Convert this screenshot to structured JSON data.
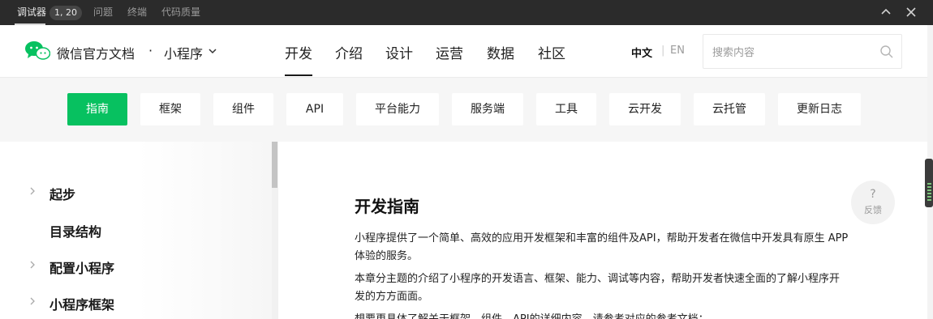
{
  "devtools": {
    "tabs": [
      {
        "label": "调试器",
        "active": true
      },
      {
        "label": "问题"
      },
      {
        "label": "终端"
      },
      {
        "label": "代码质量"
      }
    ],
    "badge": "1, 20",
    "collapse_icon": "chevron-up-icon",
    "close_icon": "close-icon"
  },
  "header": {
    "site_title": "微信官方文档",
    "separator": "·",
    "product": "小程序",
    "nav": [
      {
        "label": "开发",
        "active": true
      },
      {
        "label": "介绍"
      },
      {
        "label": "设计"
      },
      {
        "label": "运营"
      },
      {
        "label": "数据"
      },
      {
        "label": "社区"
      }
    ],
    "lang": {
      "zh": "中文",
      "sep": "|",
      "en": "EN"
    },
    "search": {
      "placeholder": "搜索内容",
      "value": ""
    }
  },
  "categories": [
    {
      "label": "指南",
      "active": true
    },
    {
      "label": "框架"
    },
    {
      "label": "组件"
    },
    {
      "label": "API"
    },
    {
      "label": "平台能力"
    },
    {
      "label": "服务端"
    },
    {
      "label": "工具"
    },
    {
      "label": "云开发"
    },
    {
      "label": "云托管"
    },
    {
      "label": "更新日志"
    }
  ],
  "sidebar": {
    "items": [
      {
        "label": "起步",
        "expandable": true
      },
      {
        "label": "目录结构",
        "expandable": false
      },
      {
        "label": "配置小程序",
        "expandable": true
      },
      {
        "label": "小程序框架",
        "expandable": true
      }
    ]
  },
  "content": {
    "title": "开发指南",
    "paragraphs": [
      "小程序提供了一个简单、高效的应用开发框架和丰富的组件及API，帮助开发者在微信中开发具有原生 APP 体验的服务。",
      "本章分主题的介绍了小程序的开发语言、框架、能力、调试等内容，帮助开发者快速全面的了解小程序开发的方方面面。",
      "想要更具体了解关于框架、组件、API的详细内容，请参考对应的参考文档："
    ]
  },
  "feedback": {
    "icon": "?",
    "label": "反馈"
  },
  "colors": {
    "accent": "#07c160",
    "devbar": "#2b2b2b"
  }
}
